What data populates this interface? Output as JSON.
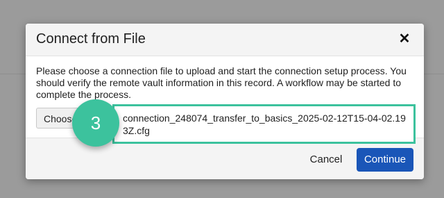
{
  "dialog": {
    "title": "Connect from File",
    "close_icon": "close-icon",
    "close_glyph": "✕",
    "body_text": "Please choose a connection file to upload and start the connection setup process. You should verify the remote vault information in this record. A workflow may be started to complete the process.",
    "choose_label": "Choose File",
    "file_name": "connection_248074_transfer_to_basics_2025-02-12T15-04-02.193Z.cfg",
    "cancel_label": "Cancel",
    "continue_label": "Continue"
  },
  "annotation": {
    "step_number": "3"
  },
  "colors": {
    "accent": "#3cc29d",
    "primary_button": "#1a56b8",
    "overlay": "#9b9b9b"
  }
}
